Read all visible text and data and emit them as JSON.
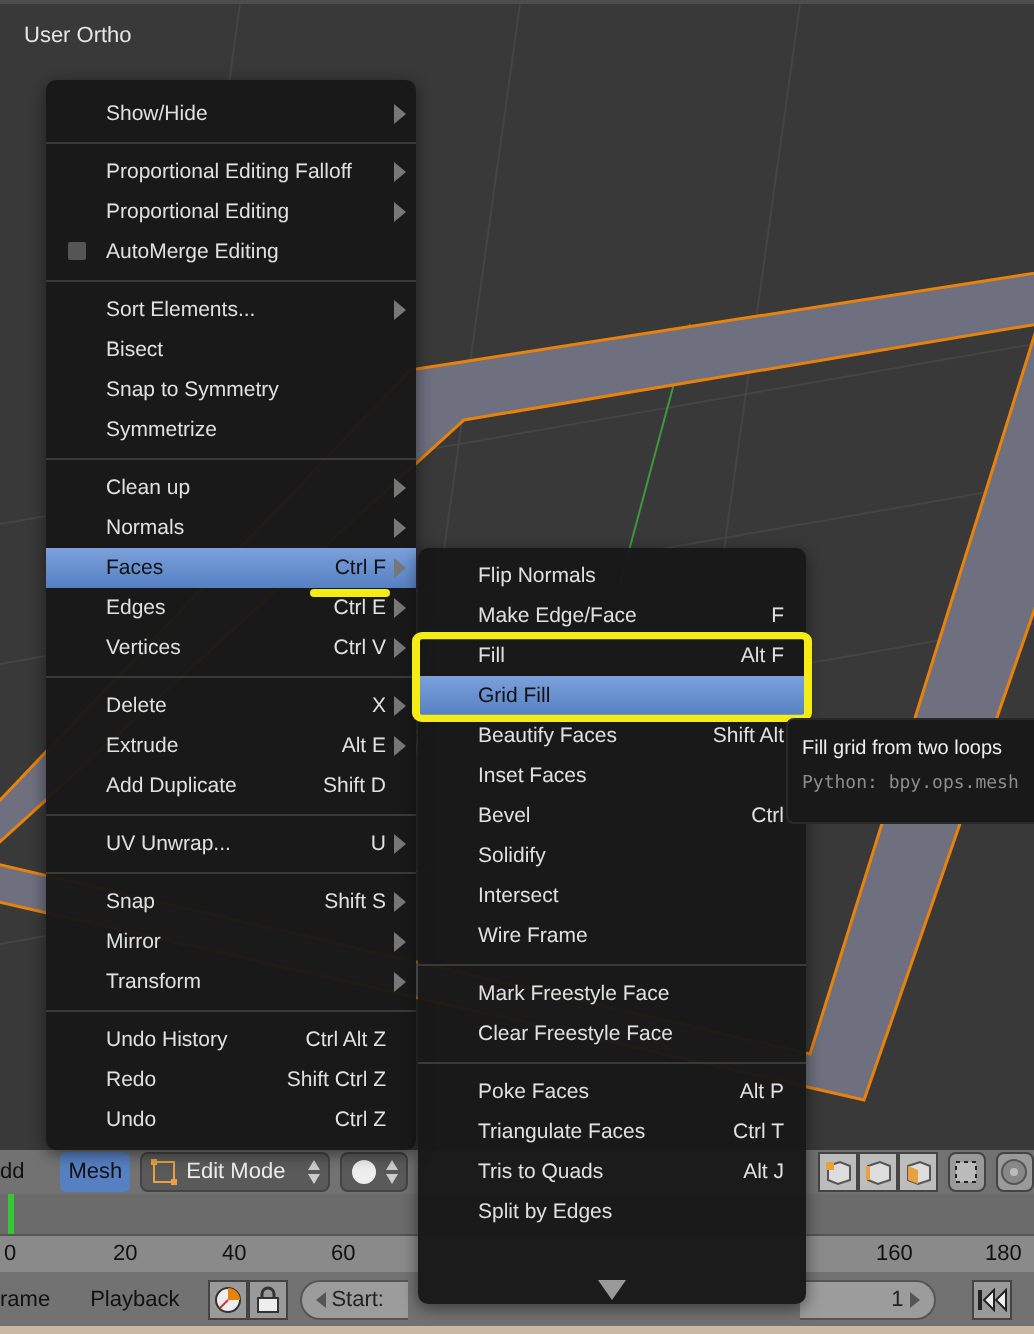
{
  "viewport": {
    "title": "User Ortho"
  },
  "mesh_menu": {
    "sections": [
      [
        {
          "label": "Show/Hide",
          "kind": "command",
          "submenu": true,
          "selected": false
        }
      ],
      [
        {
          "label": "Proportional Editing Falloff",
          "kind": "command",
          "submenu": true,
          "selected": false
        },
        {
          "label": "Proportional Editing",
          "kind": "command",
          "submenu": true,
          "selected": false
        },
        {
          "label": "AutoMerge Editing",
          "kind": "checkbox",
          "checked": false,
          "submenu": false,
          "selected": false
        }
      ],
      [
        {
          "label": "Sort Elements...",
          "kind": "command",
          "submenu": true,
          "selected": false
        },
        {
          "label": "Bisect",
          "kind": "command",
          "submenu": false,
          "selected": false
        },
        {
          "label": "Snap to Symmetry",
          "kind": "command",
          "submenu": false,
          "selected": false
        },
        {
          "label": "Symmetrize",
          "kind": "command",
          "submenu": false,
          "selected": false
        }
      ],
      [
        {
          "label": "Clean up",
          "kind": "command",
          "submenu": true,
          "selected": false
        },
        {
          "label": "Normals",
          "kind": "command",
          "submenu": true,
          "selected": false
        },
        {
          "label": "Faces",
          "shortcut": "Ctrl F",
          "kind": "command",
          "submenu": true,
          "selected": true
        },
        {
          "label": "Edges",
          "shortcut": "Ctrl E",
          "kind": "command",
          "submenu": true,
          "selected": false
        },
        {
          "label": "Vertices",
          "shortcut": "Ctrl V",
          "kind": "command",
          "submenu": true,
          "selected": false
        }
      ],
      [
        {
          "label": "Delete",
          "shortcut": "X",
          "kind": "command",
          "submenu": true,
          "selected": false
        },
        {
          "label": "Extrude",
          "shortcut": "Alt E",
          "kind": "command",
          "submenu": true,
          "selected": false
        },
        {
          "label": "Add Duplicate",
          "shortcut": "Shift D",
          "kind": "command",
          "submenu": false,
          "selected": false
        }
      ],
      [
        {
          "label": "UV Unwrap...",
          "shortcut": "U",
          "kind": "command",
          "submenu": true,
          "selected": false
        }
      ],
      [
        {
          "label": "Snap",
          "shortcut": "Shift S",
          "kind": "command",
          "submenu": true,
          "selected": false
        },
        {
          "label": "Mirror",
          "kind": "command",
          "submenu": true,
          "selected": false
        },
        {
          "label": "Transform",
          "kind": "command",
          "submenu": true,
          "selected": false
        }
      ],
      [
        {
          "label": "Undo History",
          "shortcut": "Ctrl Alt Z",
          "kind": "command",
          "submenu": false,
          "selected": false
        },
        {
          "label": "Redo",
          "shortcut": "Shift Ctrl Z",
          "kind": "command",
          "submenu": false,
          "selected": false
        },
        {
          "label": "Undo",
          "shortcut": "Ctrl Z",
          "kind": "command",
          "submenu": false,
          "selected": false
        }
      ]
    ]
  },
  "faces_menu": {
    "sections": [
      [
        {
          "label": "Flip Normals",
          "selected": false
        },
        {
          "label": "Make Edge/Face",
          "shortcut": "F",
          "selected": false
        },
        {
          "label": "Fill",
          "shortcut": "Alt F",
          "selected": false
        },
        {
          "label": "Grid Fill",
          "selected": true
        },
        {
          "label": "Beautify Faces",
          "shortcut": "Shift Alt",
          "selected": false
        },
        {
          "label": "Inset Faces",
          "selected": false
        },
        {
          "label": "Bevel",
          "shortcut": "Ctrl",
          "selected": false
        },
        {
          "label": "Solidify",
          "selected": false
        },
        {
          "label": "Intersect",
          "selected": false
        },
        {
          "label": "Wire Frame",
          "selected": false
        }
      ],
      [
        {
          "label": "Mark Freestyle Face",
          "selected": false
        },
        {
          "label": "Clear Freestyle Face",
          "selected": false
        }
      ],
      [
        {
          "label": "Poke Faces",
          "shortcut": "Alt P",
          "selected": false
        },
        {
          "label": "Triangulate Faces",
          "shortcut": "Ctrl T",
          "selected": false
        },
        {
          "label": "Tris to Quads",
          "shortcut": "Alt J",
          "selected": false
        },
        {
          "label": "Split by Edges",
          "selected": false
        }
      ]
    ]
  },
  "tooltip": {
    "title": "Fill grid from two loops",
    "python": "Python: bpy.ops.mesh"
  },
  "view_header": {
    "view_menu": "dd",
    "mesh_menu": {
      "label": "Mesh",
      "selected": true
    },
    "mode": "Edit Mode"
  },
  "timeline": {
    "ruler_start": [
      "0",
      "20",
      "40",
      "60"
    ],
    "ruler_end": [
      "160",
      "180"
    ],
    "menus": [
      "rame",
      "Playback"
    ],
    "start": {
      "label": "Start:"
    },
    "current_frame": "1"
  }
}
